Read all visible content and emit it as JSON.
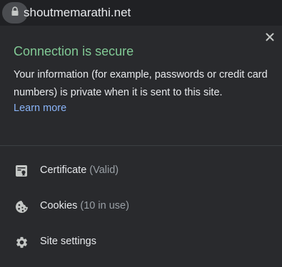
{
  "address_bar": {
    "url": "shoutmemarathi.net",
    "lock_icon": "lock-icon"
  },
  "popup": {
    "close_icon": "close-icon",
    "title": "Connection is secure",
    "description": "Your information (for example, passwords or credit card numbers) is private when it is sent to this site.",
    "learn_more": "Learn more",
    "items": [
      {
        "icon": "certificate-icon",
        "label": "Certificate",
        "detail": "(Valid)"
      },
      {
        "icon": "cookie-icon",
        "label": "Cookies",
        "detail": "(10 in use)"
      },
      {
        "icon": "gear-icon",
        "label": "Site settings",
        "detail": ""
      }
    ]
  },
  "colors": {
    "background": "#202124",
    "panel": "#292a2d",
    "secure_green": "#81c995",
    "link_blue": "#8ab4f8",
    "text": "#e8eaed",
    "muted": "#9aa0a6"
  }
}
